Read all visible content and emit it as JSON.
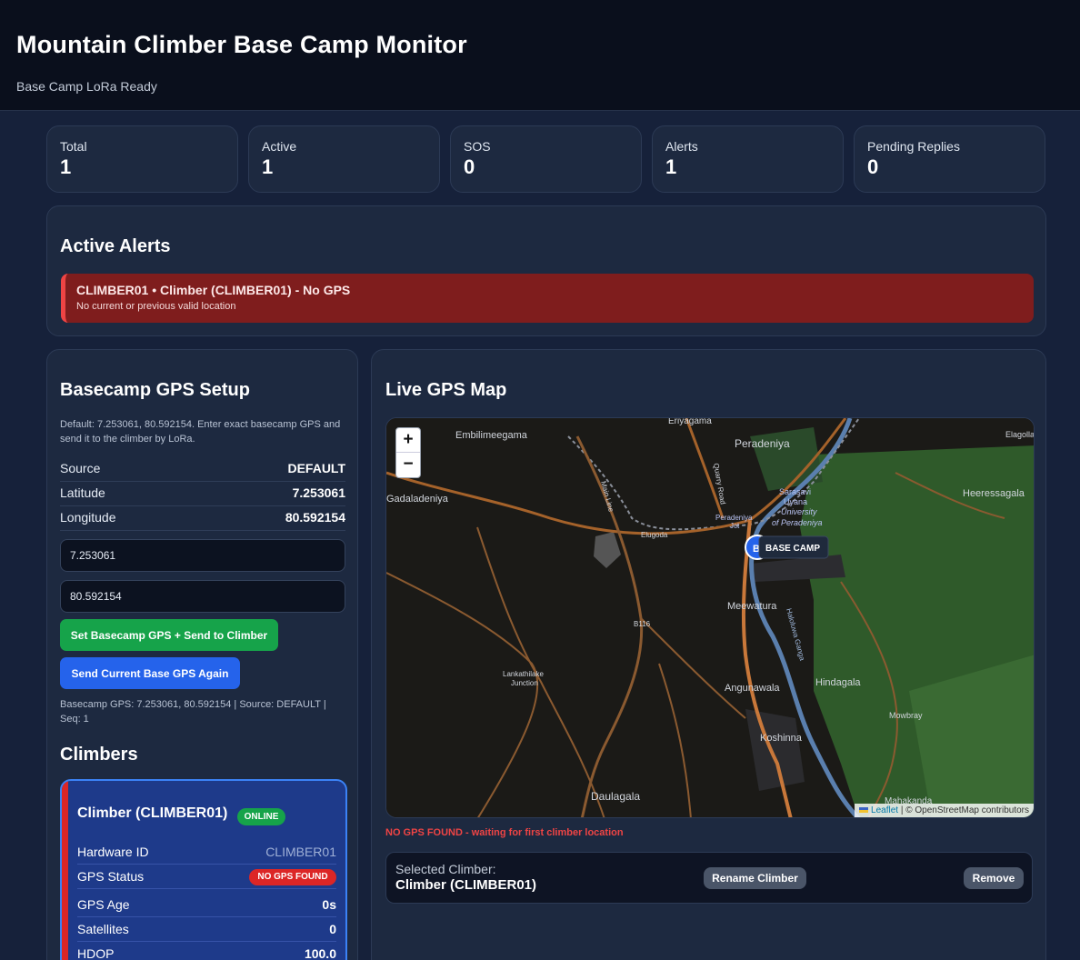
{
  "header": {
    "title": "Mountain Climber Base Camp Monitor",
    "subtitle": "Base Camp LoRa Ready"
  },
  "stats": [
    {
      "label": "Total",
      "value": "1"
    },
    {
      "label": "Active",
      "value": "1"
    },
    {
      "label": "SOS",
      "value": "0"
    },
    {
      "label": "Alerts",
      "value": "1"
    },
    {
      "label": "Pending Replies",
      "value": "0"
    }
  ],
  "alerts": {
    "title": "Active Alerts",
    "items": [
      {
        "title": "CLIMBER01 • Climber (CLIMBER01) - No GPS",
        "desc": "No current or previous valid location"
      }
    ]
  },
  "basecamp": {
    "title": "Basecamp GPS Setup",
    "hint": "Default: 7.253061, 80.592154. Enter exact basecamp GPS and send it to the climber by LoRa.",
    "rows": [
      {
        "key": "Source",
        "value": "DEFAULT"
      },
      {
        "key": "Latitude",
        "value": "7.253061"
      },
      {
        "key": "Longitude",
        "value": "80.592154"
      }
    ],
    "lat_input": "7.253061",
    "lon_input": "80.592154",
    "set_button": "Set Basecamp GPS + Send to Climber",
    "resend_button": "Send Current Base GPS Again",
    "status": "Basecamp GPS: 7.253061, 80.592154 | Source: DEFAULT | Seq: 1"
  },
  "climbers": {
    "title": "Climbers",
    "items": [
      {
        "name": "Climber (CLIMBER01)",
        "badge": "ONLINE",
        "rows": [
          {
            "key": "Hardware ID",
            "value": "CLIMBER01"
          },
          {
            "key": "GPS Status",
            "value": "NO GPS FOUND"
          },
          {
            "key": "GPS Age",
            "value": "0s"
          },
          {
            "key": "Satellites",
            "value": "0"
          },
          {
            "key": "HDOP",
            "value": "100.0"
          }
        ]
      }
    ]
  },
  "map": {
    "title": "Live GPS Map",
    "zoom_in": "+",
    "zoom_out": "−",
    "marker_letter": "B",
    "marker_label": "BASE CAMP",
    "places": [
      "Embilimeegama",
      "Peradeniya",
      "Gadaladeniya",
      "Sarasavi",
      "Uyana",
      "University",
      "of Peradeniya",
      "Peradeniya",
      "Jct",
      "Heeressagala",
      "Elagolla",
      "Eriyagama",
      "Elugoda",
      "Meewatura",
      "Lankathilake",
      "Junction",
      "Angunawala",
      "Hindagala",
      "Mowbray",
      "Koshinna",
      "Daulagala",
      "Mahakanda",
      "B116",
      "Quarry Road",
      "Main Line",
      "Haloluwa Ganga"
    ],
    "attribution_link": "Leaflet",
    "attribution_text": "| © OpenStreetMap contributors",
    "colors": {
      "land": "#1b1a17",
      "forest": "#2f5a2a",
      "road": "#a5622a",
      "river": "#5a7fae"
    }
  },
  "map_status": "NO GPS FOUND - waiting for first climber location",
  "selected": {
    "label": "Selected Climber:",
    "name": "Climber (CLIMBER01)",
    "rename_button": "Rename Climber",
    "remove_button": "Remove"
  }
}
